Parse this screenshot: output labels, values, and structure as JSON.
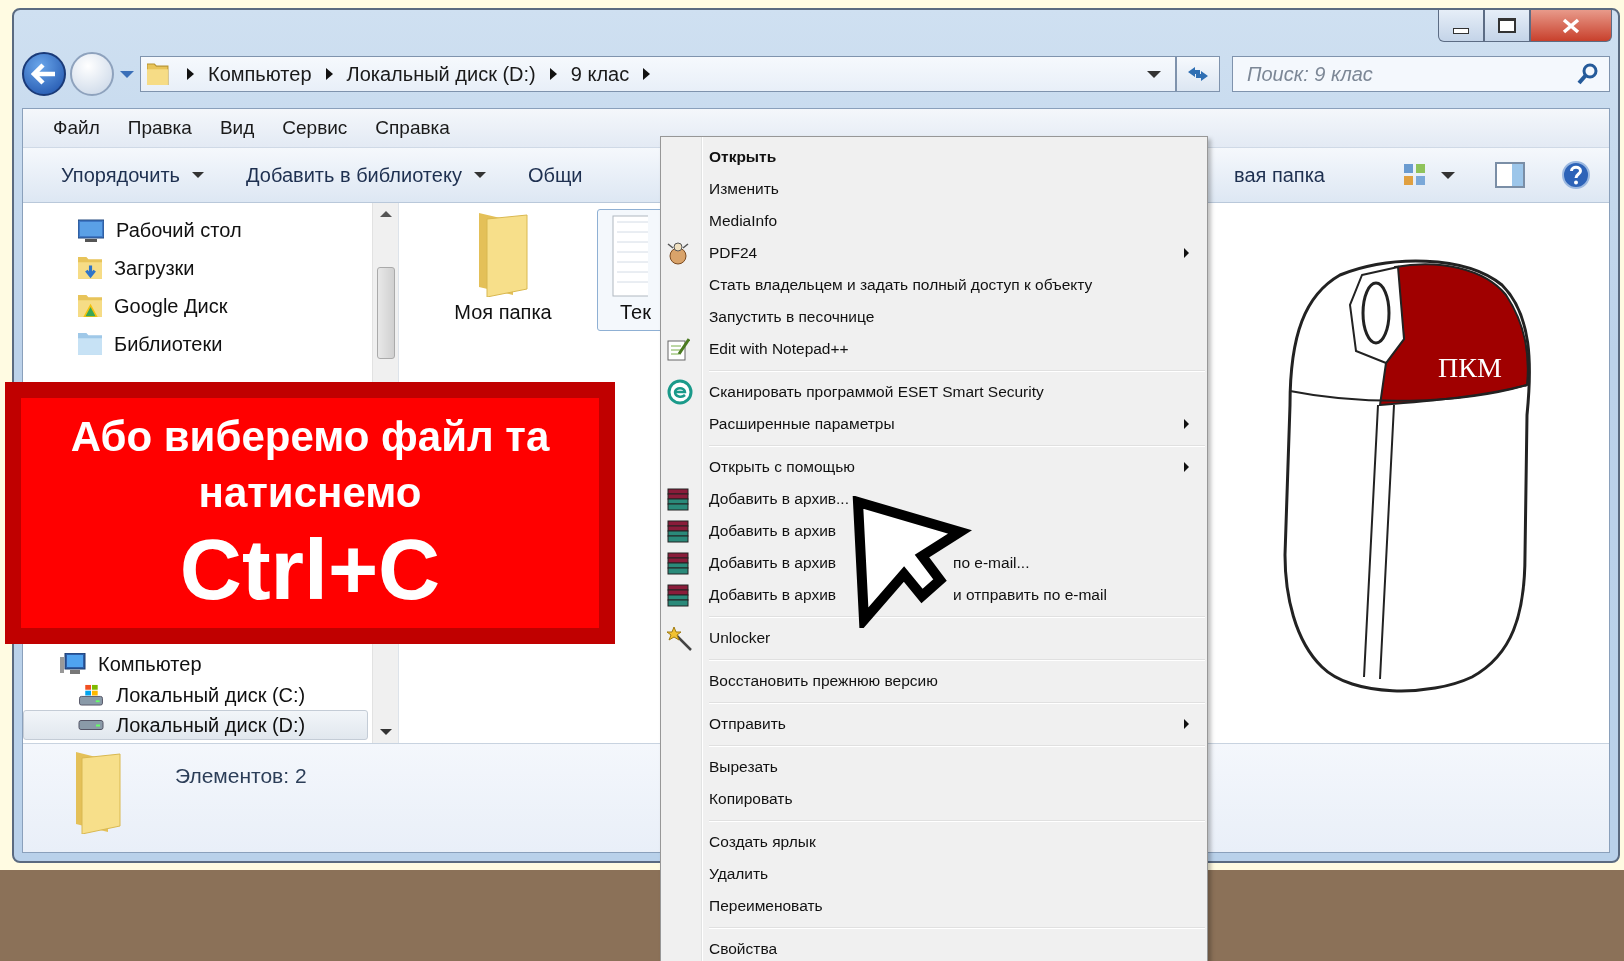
{
  "address_bar": {
    "breadcrumbs": [
      "Компьютер",
      "Локальный диск (D:)",
      "9 клас"
    ]
  },
  "search": {
    "placeholder": "Поиск: 9 клас"
  },
  "menu_bar": [
    "Файл",
    "Правка",
    "Вид",
    "Сервис",
    "Справка"
  ],
  "toolbar": {
    "buttons": [
      {
        "label": "Упорядочить",
        "dropdown": true
      },
      {
        "label": "Добавить в библиотеку",
        "dropdown": true
      },
      {
        "label": "Общи",
        "dropdown": false
      }
    ],
    "right_button": "вая папка"
  },
  "nav_pane": {
    "favorites": [
      {
        "label": "Рабочий стол",
        "selected": false
      },
      {
        "label": "Загрузки",
        "selected": false
      },
      {
        "label": "Google Диск",
        "selected": false
      },
      {
        "label": "Библиотеки",
        "selected": false
      }
    ],
    "computer": {
      "label": "Компьютер",
      "selected": false,
      "children": [
        {
          "label": "Локальный диск (C:)",
          "selected": false
        },
        {
          "label": "Локальный диск (D:)",
          "selected": true
        }
      ]
    }
  },
  "files": [
    {
      "name": "Моя папка",
      "kind": "folder",
      "selected": false
    },
    {
      "name": "Тек",
      "kind": "text-file",
      "selected": true
    }
  ],
  "status_bar": {
    "count": "Элементов: 2"
  },
  "context_menu": [
    [
      {
        "label": "Открыть",
        "kind": "default",
        "submenu": false
      },
      {
        "label": "Изменить",
        "kind": "item",
        "submenu": false
      },
      {
        "label": "MediaInfo",
        "kind": "item",
        "submenu": false
      },
      {
        "label": "PDF24",
        "kind": "item",
        "submenu": true
      },
      {
        "label": "Стать владельцем и задать полный доступ к объекту",
        "kind": "item",
        "submenu": false
      },
      {
        "label": "Запустить в песочнице",
        "kind": "item",
        "submenu": false
      },
      {
        "label": "Edit with Notepad++",
        "kind": "item",
        "submenu": false
      }
    ],
    [
      {
        "label": "Сканировать программой ESET Smart Security",
        "kind": "item",
        "submenu": false
      },
      {
        "label": "Расширенные параметры",
        "kind": "item",
        "submenu": true
      }
    ],
    [
      {
        "label": "Открыть с помощью",
        "kind": "item",
        "submenu": true
      },
      {
        "label": "Добавить в архив...",
        "kind": "item",
        "submenu": false
      },
      {
        "label": "Добавить в архив",
        "kind": "item",
        "submenu": false
      },
      {
        "label": "Добавить в архив",
        "kind": "item",
        "submenu": false,
        "tail": "по e-mail..."
      },
      {
        "label": "Добавить в архив",
        "kind": "item",
        "submenu": false,
        "tail": "и отправить по e-mail"
      }
    ],
    [
      {
        "label": "Unlocker",
        "kind": "item",
        "submenu": false
      }
    ],
    [
      {
        "label": "Восстановить прежнюю версию",
        "kind": "item",
        "submenu": false
      }
    ],
    [
      {
        "label": "Отправить",
        "kind": "item",
        "submenu": true
      }
    ],
    [
      {
        "label": "Вырезать",
        "kind": "item",
        "submenu": false
      },
      {
        "label": "Копировать",
        "kind": "item",
        "submenu": false
      }
    ],
    [
      {
        "label": "Создать ярлык",
        "kind": "item",
        "submenu": false
      },
      {
        "label": "Удалить",
        "kind": "item",
        "submenu": false
      },
      {
        "label": "Переименовать",
        "kind": "item",
        "submenu": false
      }
    ],
    [
      {
        "label": "Свойства",
        "kind": "item",
        "submenu": false
      }
    ]
  ],
  "callout": {
    "text": "Або виберемо файл та натиснемо",
    "shortcut": "Ctrl+C"
  },
  "mouse": {
    "button_label": "ПКМ"
  }
}
